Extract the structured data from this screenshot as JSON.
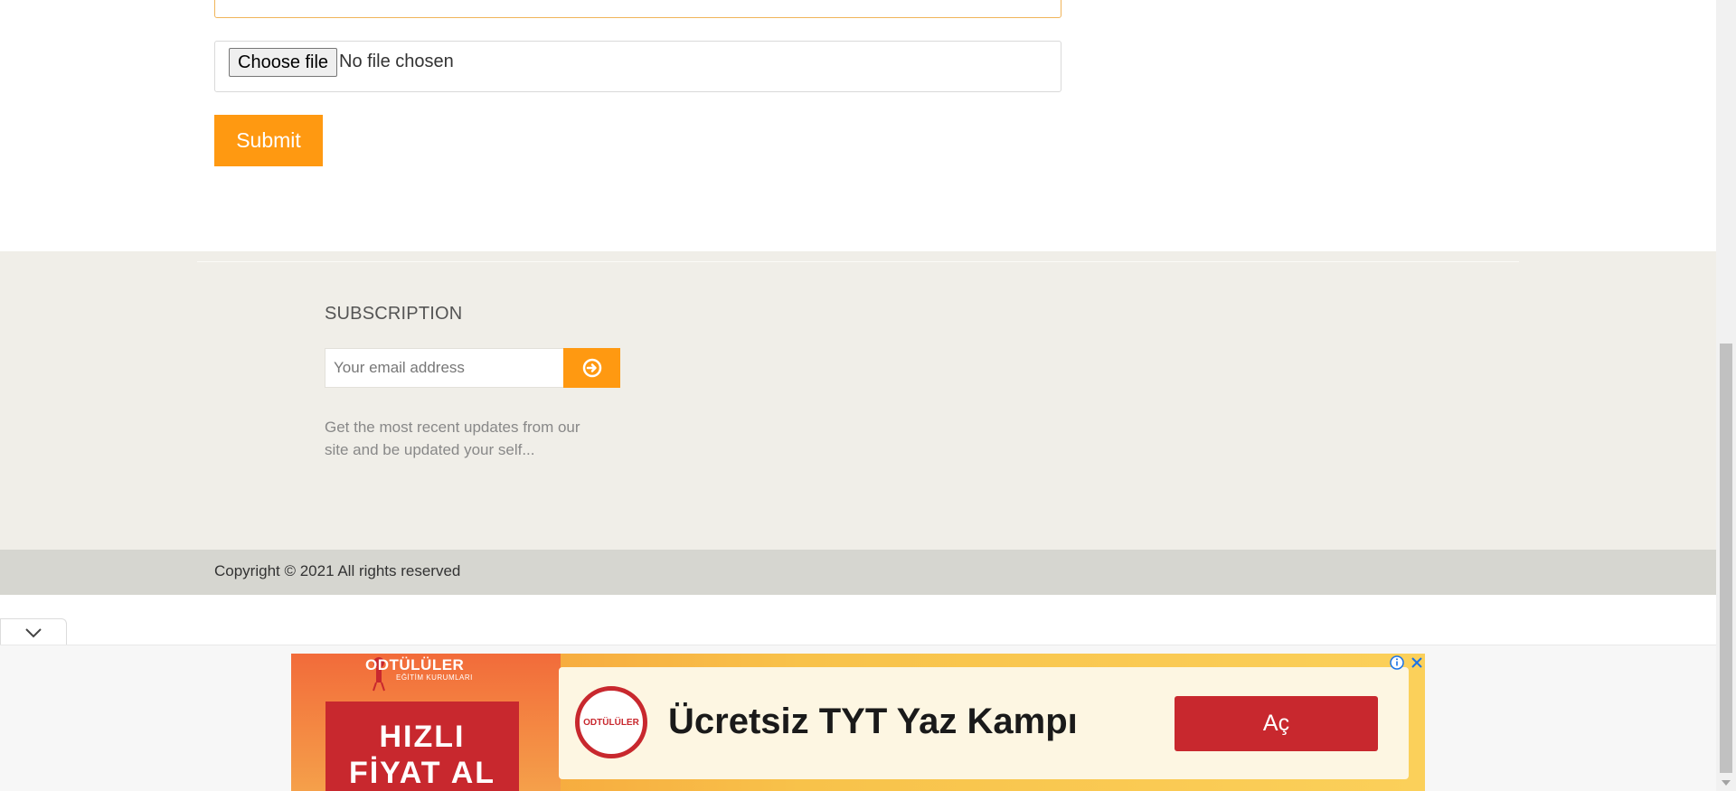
{
  "form": {
    "file_button_label": "Choose file",
    "file_status": "No file chosen",
    "submit_label": "Submit"
  },
  "footer": {
    "subscription_heading": "SUBSCRIPTION",
    "email_placeholder": "Your email address",
    "subscribe_icon": "circle-arrow-right-icon",
    "description": "Get the most recent updates from our site and be updated your self...",
    "copyright": "Copyright © 2021 All rights reserved"
  },
  "collapse_tab": {
    "icon": "chevron-down-icon"
  },
  "ad": {
    "brand": "ODTÜLÜLER",
    "brand_sub": "EĞİTİM KURUMLARI",
    "promo_line1": "HIZLI",
    "promo_line2": "FİYAT AL",
    "logo_text": "ODTÜLÜLER",
    "headline": "Ücretsiz TYT Yaz Kampı",
    "cta_label": "Aç",
    "accent_color": "#c8282e"
  },
  "colors": {
    "primary_orange": "#ff9911",
    "footer_bg": "#f0eee8",
    "copyright_bg": "#d6d6d0"
  }
}
